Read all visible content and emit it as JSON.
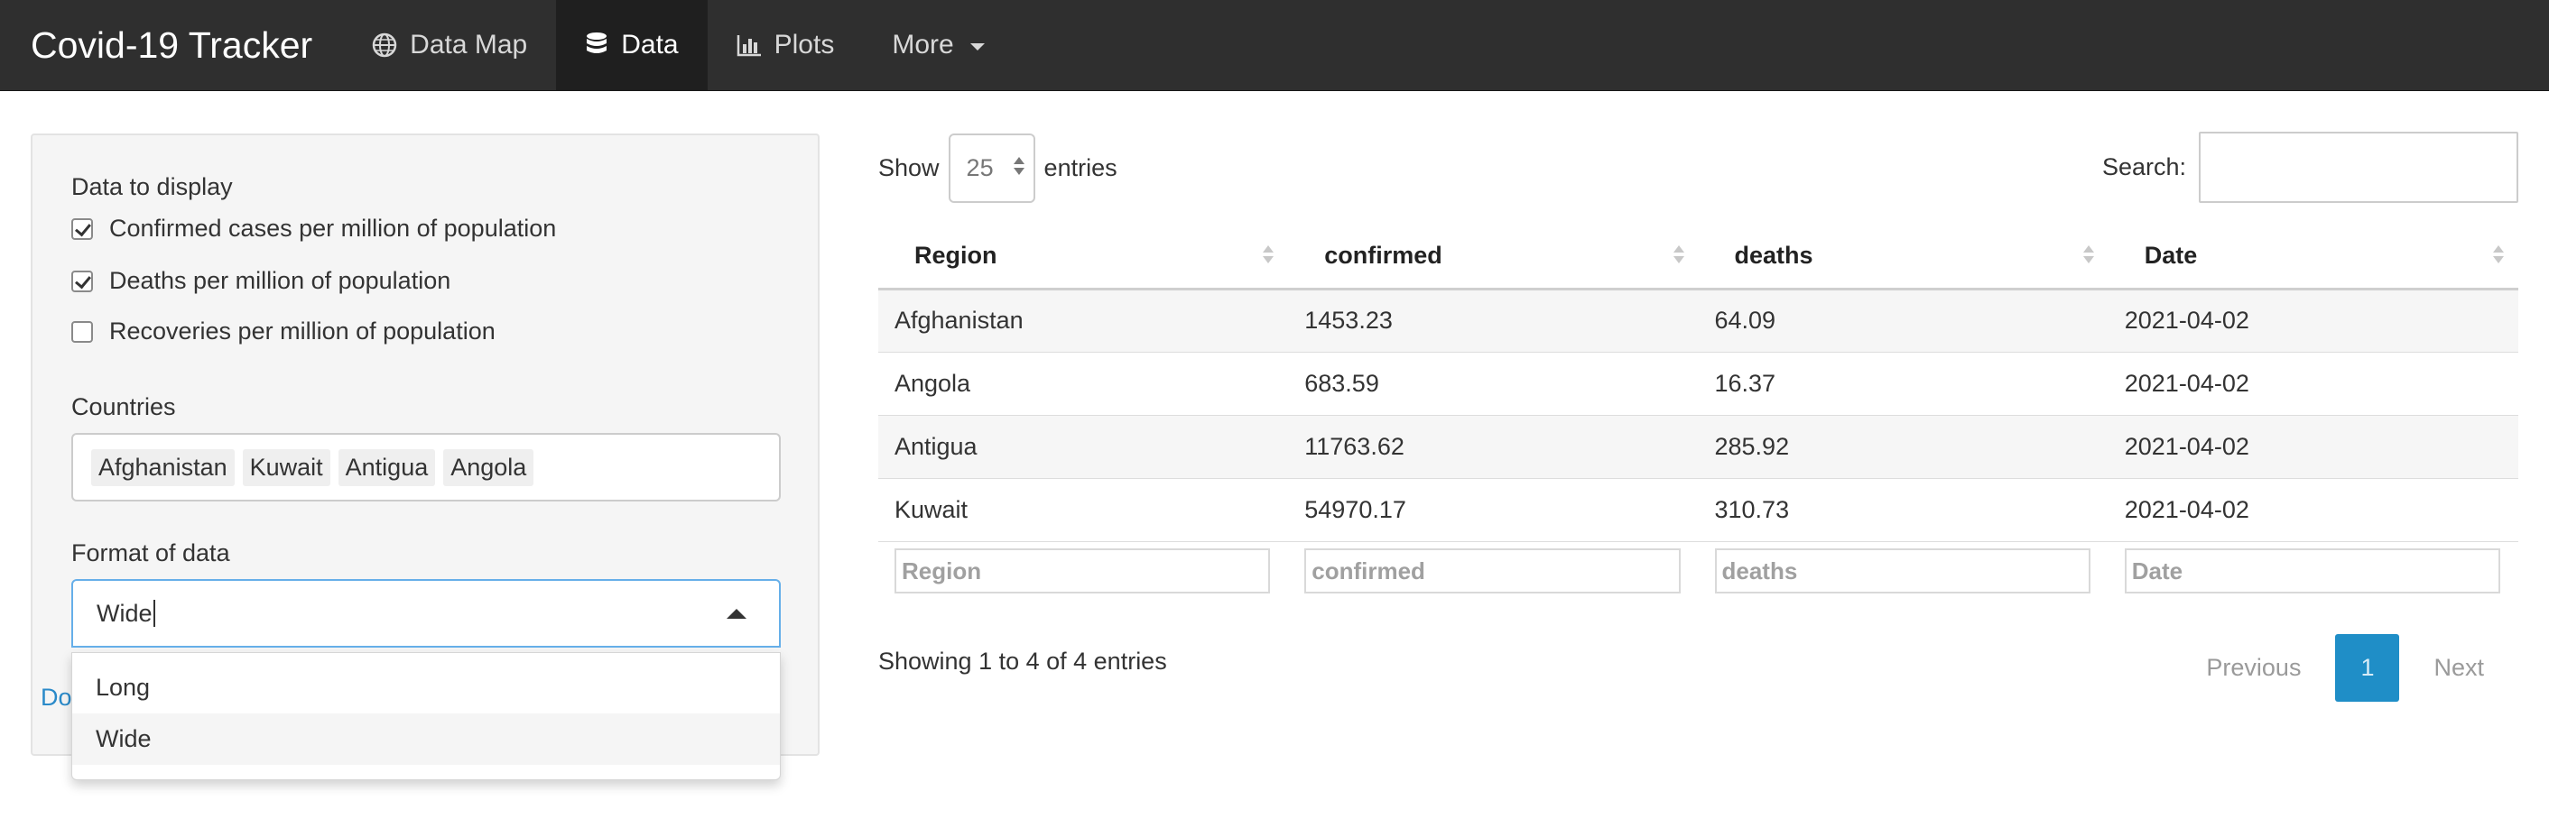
{
  "navbar": {
    "brand": "Covid-19 Tracker",
    "items": [
      {
        "label": "Data Map",
        "icon": "globe-icon",
        "active": false
      },
      {
        "label": "Data",
        "icon": "database-icon",
        "active": true
      },
      {
        "label": "Plots",
        "icon": "bar-chart-icon",
        "active": false
      },
      {
        "label": "More",
        "icon": "caret-down-icon",
        "active": false
      }
    ]
  },
  "sidebar": {
    "data_label": "Data to display",
    "checkboxes": [
      {
        "label": "Confirmed cases per million of population",
        "checked": true
      },
      {
        "label": "Deaths per million of population",
        "checked": true
      },
      {
        "label": "Recoveries per million of population",
        "checked": false
      }
    ],
    "countries_label": "Countries",
    "countries": [
      "Afghanistan",
      "Kuwait",
      "Antigua",
      "Angola"
    ],
    "format_label": "Format of data",
    "format_value": "Wide",
    "format_options": [
      "Long",
      "Wide"
    ],
    "download_partial": "Do"
  },
  "table": {
    "show_label": "Show",
    "entries_value": "25",
    "entries_label": "entries",
    "search_label": "Search:",
    "columns": [
      "Region",
      "confirmed",
      "deaths",
      "Date"
    ],
    "rows": [
      [
        "Afghanistan",
        "1453.23",
        "64.09",
        "2021-04-02"
      ],
      [
        "Angola",
        "683.59",
        "16.37",
        "2021-04-02"
      ],
      [
        "Antigua",
        "11763.62",
        "285.92",
        "2021-04-02"
      ],
      [
        "Kuwait",
        "54970.17",
        "310.73",
        "2021-04-02"
      ]
    ],
    "filter_placeholders": [
      "Region",
      "confirmed",
      "deaths",
      "Date"
    ],
    "info": "Showing 1 to 4 of 4 entries",
    "pager": {
      "previous": "Previous",
      "current": "1",
      "next": "Next"
    }
  },
  "colors": {
    "navbar_bg": "#2f2f2f",
    "accent": "#1f8ec7",
    "focus_border": "#66afe9"
  }
}
